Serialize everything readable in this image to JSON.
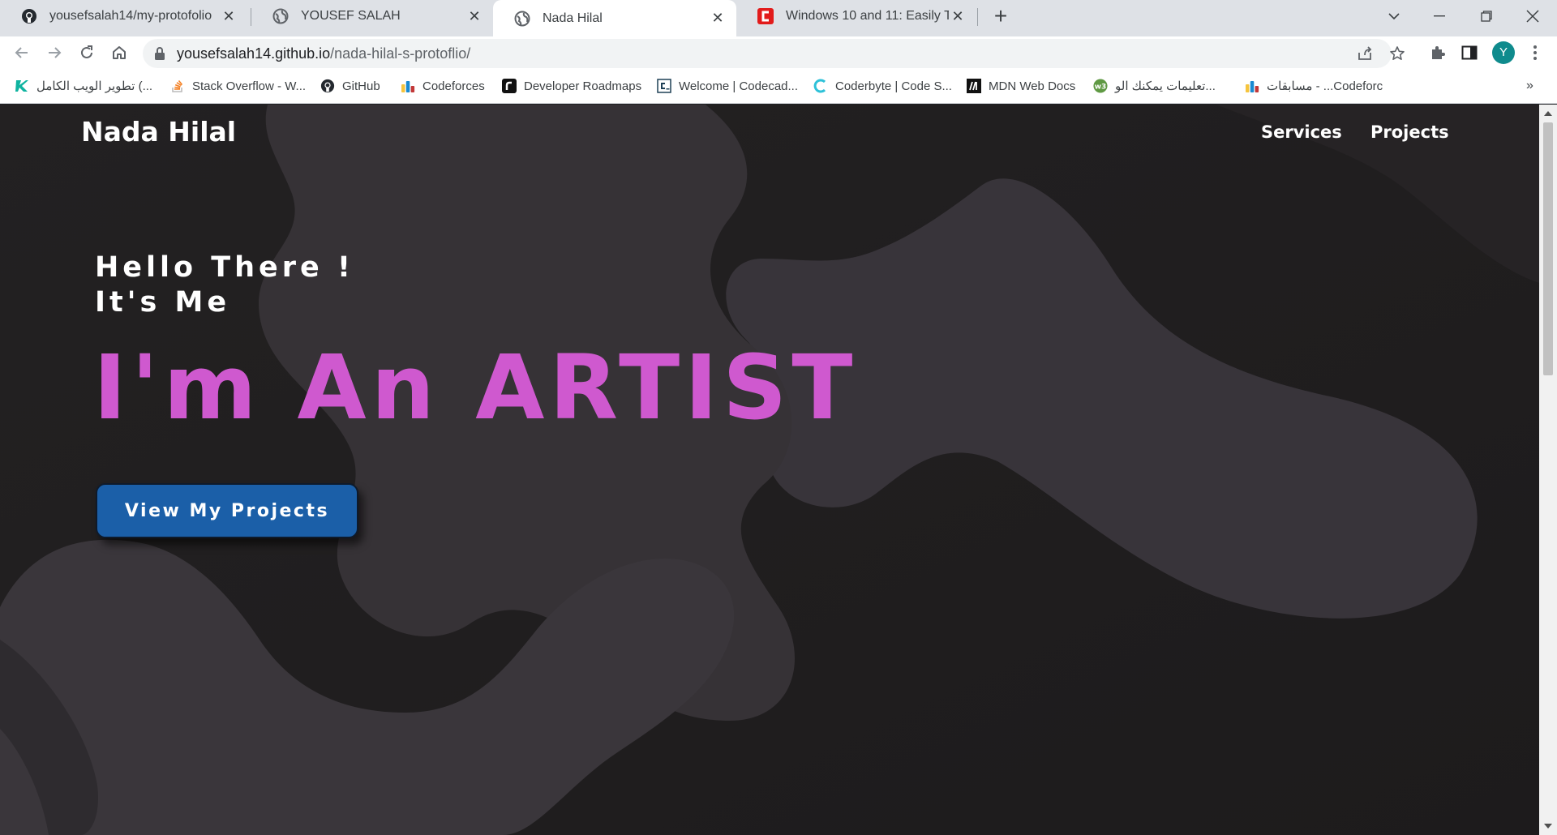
{
  "browser": {
    "tabs": [
      {
        "title": "yousefsalah14/my-protofolio",
        "icon": "github-icon"
      },
      {
        "title": "YOUSEF SALAH",
        "icon": "globe-icon"
      },
      {
        "title": "Nada Hilal",
        "icon": "globe-icon",
        "active": true
      },
      {
        "title": "Windows 10 and 11: Easily Take S",
        "icon": "cnet-icon"
      }
    ],
    "url_host": "yousefsalah14.github.io",
    "url_path": "/nada-hilal-s-protoflio/",
    "profile_initial": "Y",
    "bookmarks": [
      {
        "label": "تطوير الويب الكامل (...",
        "icon": "kareem-icon"
      },
      {
        "label": "Stack Overflow - W...",
        "icon": "stackoverflow-icon"
      },
      {
        "label": "GitHub",
        "icon": "github-icon"
      },
      {
        "label": "Codeforces",
        "icon": "codeforces-icon"
      },
      {
        "label": "Developer Roadmaps",
        "icon": "roadmap-icon"
      },
      {
        "label": "Welcome | Codecad...",
        "icon": "codecademy-icon"
      },
      {
        "label": "Coderbyte | Code S...",
        "icon": "coderbyte-icon"
      },
      {
        "label": "MDN Web Docs",
        "icon": "mdn-icon"
      },
      {
        "label": "تعليمات يمكنك الو...",
        "icon": "w3-icon"
      },
      {
        "label": "مسابقات - ...Codeforc",
        "icon": "codeforces-icon"
      }
    ]
  },
  "site": {
    "brand": "Nada Hilal",
    "nav": [
      "Services",
      "Projects"
    ],
    "hero": {
      "greeting_line1": "Hello There !",
      "greeting_line2": "It's Me",
      "headline": "I'm An ARTIST",
      "cta": "View My Projects"
    }
  },
  "colors": {
    "page_background": "#1f1d1e",
    "blob": "#3a3638",
    "headline": "#cf59cf",
    "cta_background": "#1b5fa8"
  }
}
